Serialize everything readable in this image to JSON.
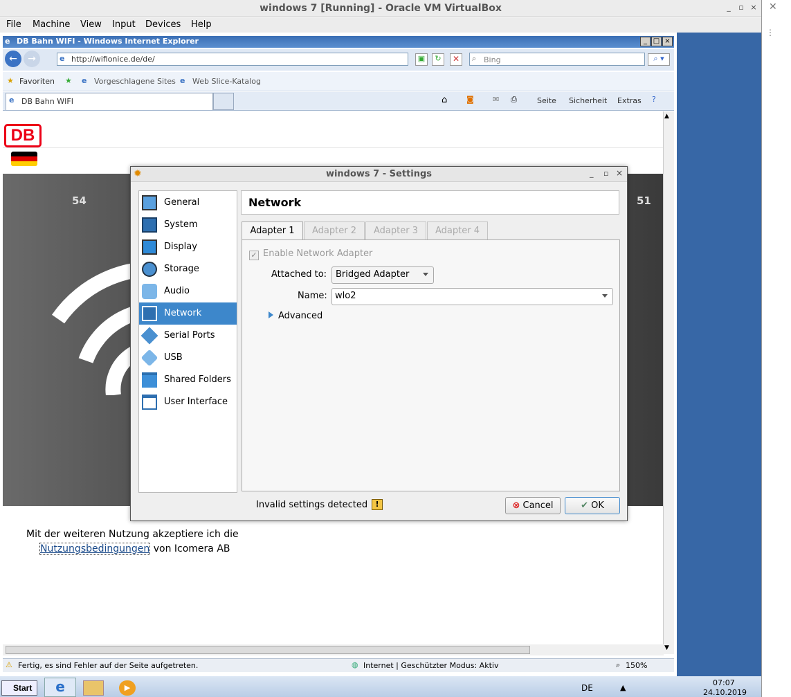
{
  "vbox": {
    "title": "windows 7 [Running] - Oracle VM VirtualBox",
    "menu": [
      "File",
      "Machine",
      "View",
      "Input",
      "Devices",
      "Help"
    ]
  },
  "ie": {
    "title": "DB Bahn WIFI - Windows Internet Explorer",
    "url": "http://wifionice.de/de/",
    "search_placeholder": "Bing",
    "favorites_label": "Favoriten",
    "suggested_sites": "Vorgeschlagene Sites",
    "web_slice": "Web Slice-Katalog",
    "tab_title": "DB Bahn WIFI",
    "cmd": {
      "page": "Seite",
      "safety": "Sicherheit",
      "extras": "Extras"
    },
    "status": {
      "message": "Fertig, es sind Fehler auf der Seite aufgetreten.",
      "zone": "Internet | Geschützter Modus: Aktiv",
      "zoom": "150%"
    }
  },
  "page": {
    "logo": "DB",
    "terms_prefix": "Mit der weiteren Nutzung akzeptiere ich die",
    "terms_link": "Nutzungsbedingungen",
    "terms_suffix": "von Icomera AB",
    "hero_numbers": [
      "54",
      "51"
    ]
  },
  "taskbar": {
    "start": "Start",
    "lang": "DE",
    "time": "07:07",
    "date": "24.10.2019"
  },
  "settings": {
    "title": "windows 7 - Settings",
    "sidebar": [
      {
        "label": "General",
        "icon": "general-icon"
      },
      {
        "label": "System",
        "icon": "system-icon"
      },
      {
        "label": "Display",
        "icon": "display-icon"
      },
      {
        "label": "Storage",
        "icon": "storage-icon"
      },
      {
        "label": "Audio",
        "icon": "audio-icon"
      },
      {
        "label": "Network",
        "icon": "network-icon",
        "selected": true
      },
      {
        "label": "Serial Ports",
        "icon": "serial-ports-icon"
      },
      {
        "label": "USB",
        "icon": "usb-icon"
      },
      {
        "label": "Shared Folders",
        "icon": "shared-folders-icon"
      },
      {
        "label": "User Interface",
        "icon": "user-interface-icon"
      }
    ],
    "page_title": "Network",
    "tabs": [
      "Adapter 1",
      "Adapter 2",
      "Adapter 3",
      "Adapter 4"
    ],
    "enable_label": "Enable Network Adapter",
    "attached_label": "Attached to:",
    "attached_value": "Bridged Adapter",
    "name_label": "Name:",
    "name_value": "wlo2",
    "advanced_label": "Advanced",
    "invalid_text": "Invalid settings detected",
    "cancel_label": "Cancel",
    "ok_label": "OK"
  },
  "colors": {
    "accent": "#3d87cb",
    "db_red": "#ec0016",
    "host_desktop": "#3767a6"
  }
}
